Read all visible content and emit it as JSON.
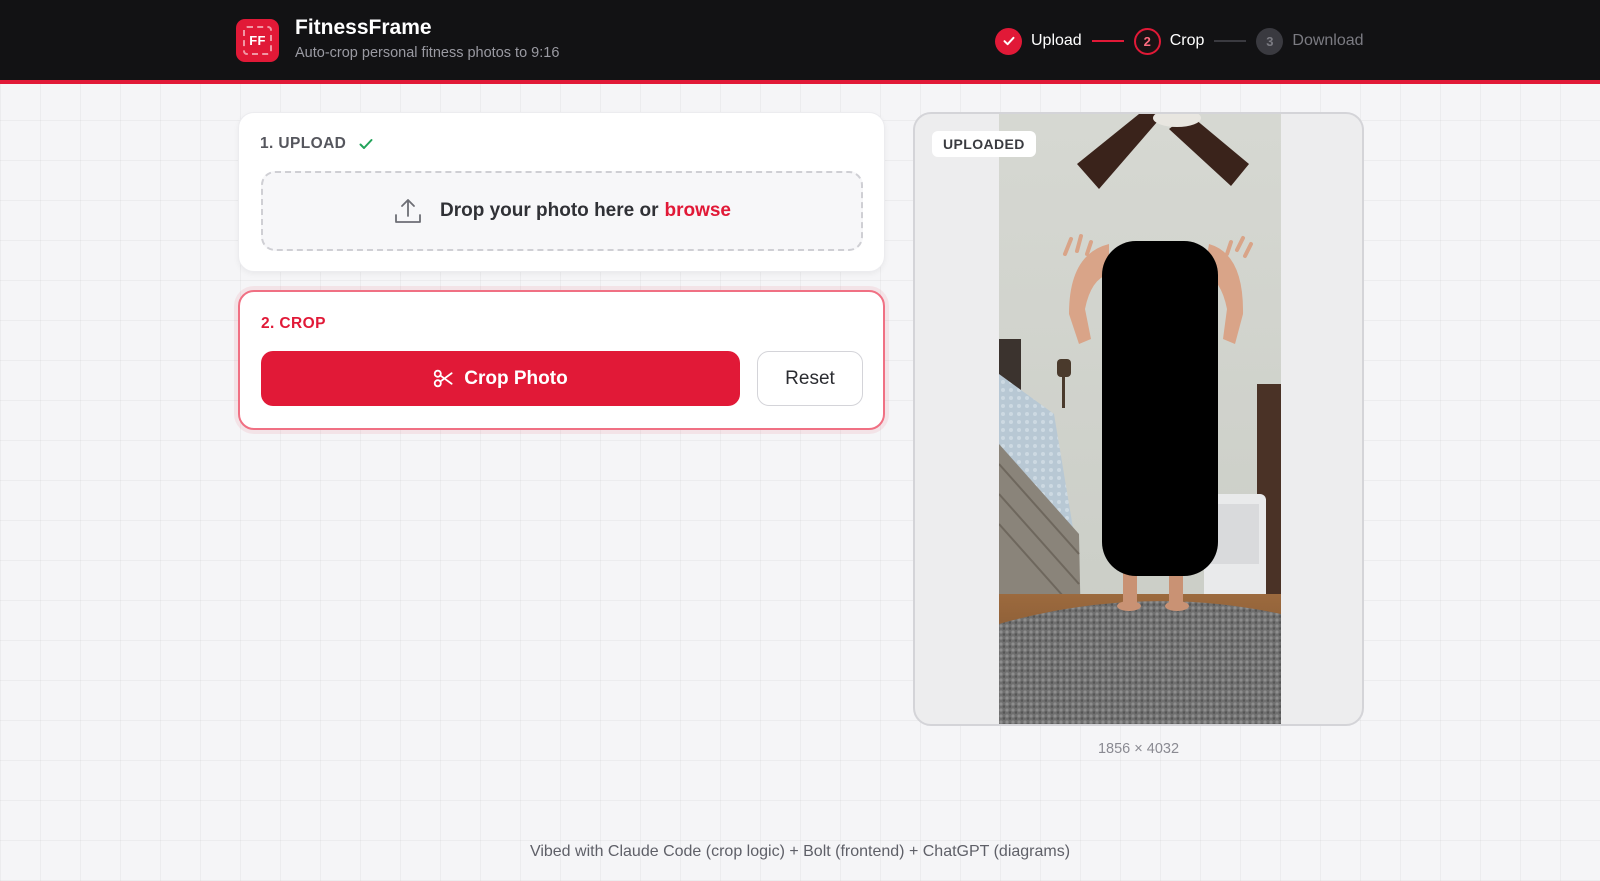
{
  "app": {
    "logo_text": "FF",
    "title": "FitnessFrame",
    "subtitle": "Auto-crop personal fitness photos to 9:16"
  },
  "steps": [
    {
      "number": "1",
      "label": "Upload",
      "state": "done"
    },
    {
      "number": "2",
      "label": "Crop",
      "state": "active"
    },
    {
      "number": "3",
      "label": "Download",
      "state": "pending"
    }
  ],
  "upload_card": {
    "heading": "1. UPLOAD",
    "drop_text": "Drop your photo here or",
    "browse_label": "browse"
  },
  "crop_card": {
    "heading": "2. CROP",
    "crop_button_label": "Crop Photo",
    "reset_button_label": "Reset"
  },
  "preview": {
    "badge": "UPLOADED",
    "dimensions": "1856 × 4032"
  },
  "footer": {
    "text": "Vibed with Claude Code (crop logic) + Bolt (frontend) + ChatGPT (diagrams)"
  },
  "colors": {
    "accent": "#e11937",
    "header_bg": "#121214",
    "success": "#22a35a"
  },
  "icons": {
    "logo": "crop-frame-icon",
    "step_done": "check-icon",
    "upload": "upload-icon",
    "crop": "scissors-icon"
  }
}
